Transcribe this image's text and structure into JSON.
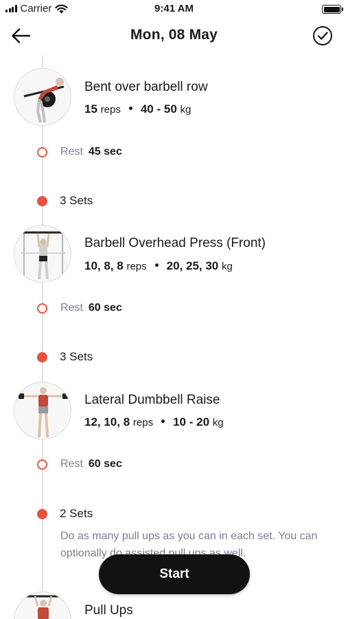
{
  "status_bar": {
    "carrier": "Carrier",
    "time": "9:41 AM",
    "icons": [
      "signal-icon",
      "wifi-icon",
      "battery-icon"
    ]
  },
  "header": {
    "title": "Mon, 08 May",
    "back_icon": "arrow-left-icon",
    "done_icon": "check-circle-icon"
  },
  "accent_color": "#e8533f",
  "exercises": [
    {
      "name": "Bent over barbell row",
      "reps": "15",
      "reps_unit": "reps",
      "weight": "40 - 50",
      "weight_unit": "kg",
      "rest_label": "Rest",
      "rest_value": "45 sec"
    },
    {
      "sets": "3 Sets",
      "name": "Barbell Overhead Press (Front)",
      "reps": "10, 8, 8",
      "reps_unit": "reps",
      "weight": "20, 25, 30",
      "weight_unit": "kg",
      "rest_label": "Rest",
      "rest_value": "60 sec"
    },
    {
      "sets": "3 Sets",
      "name": "Lateral Dumbbell Raise",
      "reps": "12, 10, 8",
      "reps_unit": "reps",
      "weight": "10 - 20",
      "weight_unit": "kg",
      "rest_label": "Rest",
      "rest_value": "60 sec"
    },
    {
      "sets": "2 Sets",
      "note": "Do as many pull ups as you can in each set. You can optionally do assisted pull ups as well.",
      "name": "Pull Ups"
    }
  ],
  "start_button": {
    "label": "Start"
  }
}
